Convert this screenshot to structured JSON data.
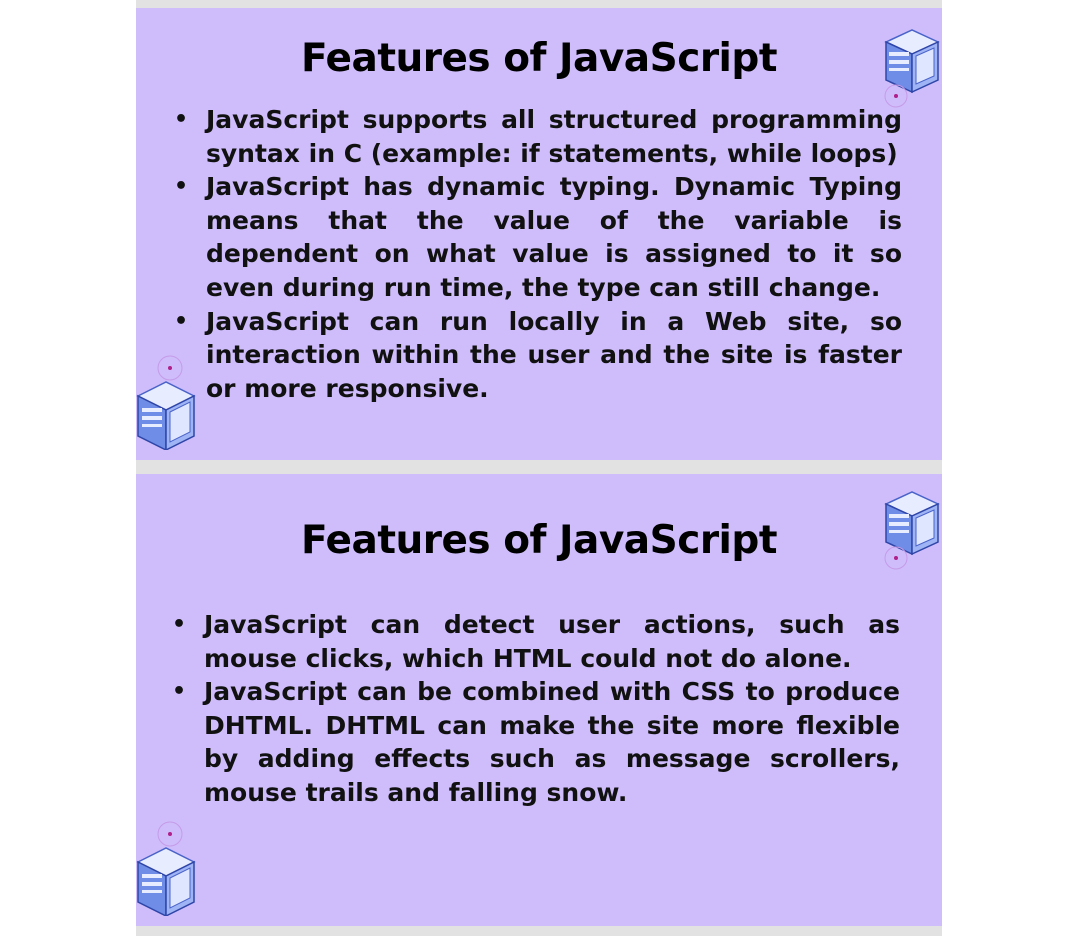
{
  "slides": [
    {
      "title": "Features of JavaScript",
      "bullets": [
        "JavaScript supports all structured programming syntax in C (example: if statements, while loops)",
        "JavaScript has dynamic typing.  Dynamic Typing means that the value of the variable is dependent on what value is assigned to it so even during run time, the type can still change.",
        "JavaScript can run locally in a Web site, so interaction within the user and the site is faster or more responsive."
      ]
    },
    {
      "title": "Features of JavaScript",
      "bullets": [
        "JavaScript can detect user actions, such as mouse clicks, which HTML could not do alone.",
        "JavaScript can be combined with CSS to produce DHTML.  DHTML can make the site more flexible by adding effects such as message scrollers, mouse trails and falling snow."
      ]
    }
  ],
  "colors": {
    "slide_background": "#cfbdfb",
    "page_background": "#ffffff",
    "text": "#000000"
  },
  "icons": [
    "server-tower-icon"
  ]
}
